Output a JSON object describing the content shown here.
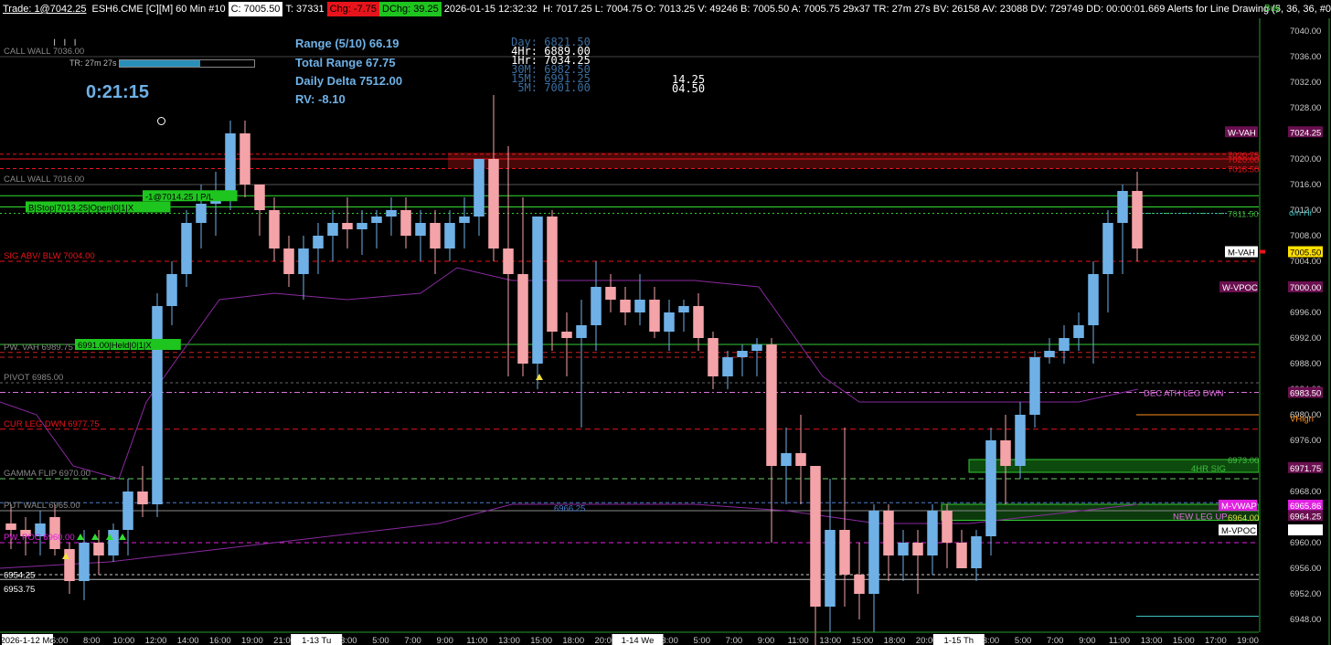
{
  "topbar": {
    "trade": "Trade: 1@7042.25",
    "symbol": "ESH6.CME [C][M]  60 Min  #10",
    "c_chip": "C: 7005.50",
    "totals": "T: 37331",
    "chg": "Chg: -7.75",
    "dchg": "DChg: 39.25",
    "datetime": "2026-01-15 12:32:32",
    "ohlc": "H: 7017.25  L: 7004.75  O: 7013.25  V: 49246  B: 7005.50  A: 7005.75  29x37  TR: 27m 27s  BV: 26158  AV: 23088  DV: 729749  DD: 00:00:01.669  Alerts for Line Drawing   (5, 36, 36, #00FFFF, Dot, 1, Yes, Right, Yes, 9"
  },
  "stats": {
    "range": "Range (5/10) 66.19",
    "total_range": "Total Range 67.75",
    "daily_delta": "Daily Delta 7512.00",
    "rv": "RV: -8.10",
    "clock": "0:21:15",
    "tr_label": "TR: 27m 27s",
    "tr_progress": 0.6
  },
  "timeframes": [
    {
      "label": "Day:",
      "value": "6821.50",
      "color": "#3a6ea0"
    },
    {
      "label": "4Hr:",
      "value": "6889.00",
      "color": "#ffffff"
    },
    {
      "label": "1Hr:",
      "value": "7034.25",
      "color": "#ffffff"
    },
    {
      "label": "30M:",
      "value": "6982.50",
      "color": "#3a6ea0"
    },
    {
      "label": "15M:",
      "value": "6991.25",
      "color": "#3a6ea0"
    },
    {
      "label": "5M:",
      "value": "7001.00",
      "color": "#3a6ea0"
    }
  ],
  "aux_values": [
    "14.25",
    "04.50"
  ],
  "right_buy_label": "Buy",
  "chart_data": {
    "type": "candlestick",
    "ylim": [
      6946,
      7042
    ],
    "y_ticks": [
      7040,
      7036,
      7032,
      7028,
      7024,
      7020,
      7016,
      7012,
      7008,
      7004,
      7000,
      6996,
      6992,
      6988,
      6984,
      6980,
      6976,
      6972,
      6968,
      6964,
      6960,
      6956,
      6952,
      6948
    ],
    "y_tick_labels": [
      "7040.00",
      "7036.00",
      "7032.00",
      "7028.00",
      "7024.00",
      "7020.00",
      "7016.00",
      "7012.00",
      "7008.00",
      "7004.00",
      "7000.00",
      "6996.00",
      "6992.00",
      "6988.00",
      "6984.00",
      "6980.00",
      "6976.00",
      "6972.00",
      "6968.00",
      "6964.00",
      "6960.00",
      "6956.00",
      "6952.00",
      "6948.00"
    ],
    "x_labels": [
      "2026-1-12 Mo",
      "6:00",
      "8:00",
      "10:00",
      "12:00",
      "14:00",
      "16:00",
      "19:00",
      "21:00",
      "1-13 Tu",
      "3:00",
      "5:00",
      "7:00",
      "9:00",
      "11:00",
      "13:00",
      "15:00",
      "18:00",
      "20:00",
      "1-14 We",
      "3:00",
      "5:00",
      "7:00",
      "9:00",
      "11:00",
      "13:00",
      "15:00",
      "18:00",
      "20:00",
      "1-15 Th",
      "3:00",
      "5:00",
      "7:00",
      "9:00",
      "11:00",
      "13:00",
      "15:00",
      "17:00",
      "19:00"
    ],
    "candles": [
      [
        6963,
        6966,
        6959,
        6962
      ],
      [
        6962,
        6964,
        6958,
        6961
      ],
      [
        6961,
        6965,
        6958,
        6963
      ],
      [
        6964,
        6966,
        6958,
        6959
      ],
      [
        6959,
        6960,
        6952,
        6954
      ],
      [
        6954,
        6962,
        6951,
        6960
      ],
      [
        6960,
        6962,
        6955,
        6958
      ],
      [
        6958,
        6963,
        6957,
        6962
      ],
      [
        6962,
        6970,
        6958,
        6968
      ],
      [
        6968,
        6972,
        6964,
        6966
      ],
      [
        6966,
        6999,
        6964,
        6997
      ],
      [
        6997,
        7004,
        6994,
        7002
      ],
      [
        7002,
        7012,
        7000,
        7010
      ],
      [
        7010,
        7016,
        7006,
        7013
      ],
      [
        7013,
        7018,
        7008,
        7014
      ],
      [
        7014,
        7026,
        7012,
        7024
      ],
      [
        7024,
        7026,
        7014,
        7016
      ],
      [
        7016,
        7016,
        7008,
        7012
      ],
      [
        7012,
        7014,
        7004,
        7006
      ],
      [
        7006,
        7008,
        7000,
        7002
      ],
      [
        7002,
        7008,
        6998,
        7006
      ],
      [
        7006,
        7010,
        7002,
        7008
      ],
      [
        7008,
        7012,
        7004,
        7010
      ],
      [
        7010,
        7014,
        7006,
        7009
      ],
      [
        7009,
        7012,
        7005,
        7010
      ],
      [
        7010,
        7012,
        7006,
        7011
      ],
      [
        7011,
        7014,
        7008,
        7012
      ],
      [
        7012,
        7014,
        7006,
        7008
      ],
      [
        7008,
        7012,
        7004,
        7010
      ],
      [
        7010,
        7012,
        7002,
        7006
      ],
      [
        7006,
        7012,
        7004,
        7010
      ],
      [
        7010,
        7014,
        7006,
        7011
      ],
      [
        7011,
        7020,
        7008,
        7020
      ],
      [
        7020,
        7030,
        7004,
        7006
      ],
      [
        7006,
        7022,
        6986,
        7002
      ],
      [
        7002,
        7014,
        6986,
        6988
      ],
      [
        6988,
        7006,
        6984,
        7011
      ],
      [
        7011,
        7012,
        6990,
        6993
      ],
      [
        6993,
        6996,
        6986,
        6992
      ],
      [
        6992,
        6998,
        6978,
        6994
      ],
      [
        6994,
        7004,
        6990,
        7000
      ],
      [
        7000,
        7002,
        6996,
        6998
      ],
      [
        6998,
        7000,
        6994,
        6996
      ],
      [
        6996,
        7002,
        6994,
        6998
      ],
      [
        6998,
        7000,
        6992,
        6993
      ],
      [
        6993,
        6998,
        6990,
        6996
      ],
      [
        6996,
        6998,
        6993,
        6997
      ],
      [
        6997,
        6999,
        6990,
        6992
      ],
      [
        6992,
        6993,
        6984,
        6986
      ],
      [
        6986,
        6990,
        6984,
        6989
      ],
      [
        6989,
        6991,
        6986,
        6990
      ],
      [
        6990,
        6992,
        6986,
        6991
      ],
      [
        6991,
        6992,
        6960,
        6972
      ],
      [
        6972,
        6978,
        6966,
        6974
      ],
      [
        6974,
        6980,
        6966,
        6972
      ],
      [
        6972,
        6972,
        6940,
        6950
      ],
      [
        6950,
        6970,
        6946,
        6962
      ],
      [
        6962,
        6978,
        6950,
        6955
      ],
      [
        6955,
        6960,
        6948,
        6952
      ],
      [
        6952,
        6966,
        6946,
        6965
      ],
      [
        6965,
        6966,
        6954,
        6958
      ],
      [
        6958,
        6962,
        6954,
        6960
      ],
      [
        6960,
        6962,
        6952,
        6958
      ],
      [
        6958,
        6966,
        6955,
        6965
      ],
      [
        6965,
        6966,
        6956,
        6960
      ],
      [
        6960,
        6962,
        6956,
        6956
      ],
      [
        6956,
        6962,
        6954,
        6961
      ],
      [
        6961,
        6978,
        6958,
        6976
      ],
      [
        6976,
        6980,
        6966,
        6972
      ],
      [
        6972,
        6982,
        6970,
        6980
      ],
      [
        6980,
        6990,
        6978,
        6989
      ],
      [
        6989,
        6992,
        6988,
        6990
      ],
      [
        6990,
        6994,
        6988,
        6992
      ],
      [
        6992,
        6996,
        6990,
        6994
      ],
      [
        6994,
        7004,
        6988,
        7002
      ],
      [
        7002,
        7012,
        6996,
        7010
      ],
      [
        7010,
        7016,
        7002,
        7015
      ],
      [
        7015,
        7018,
        7004,
        7006
      ]
    ],
    "levels": [
      {
        "name": "CALL WALL",
        "value": "7036.00",
        "color": "#888888"
      },
      {
        "name": "CALL WALL",
        "value": "7016.00",
        "color": "#888888"
      },
      {
        "name": "SIG ABV/ BLW",
        "value": "7004.00",
        "color": "#e8141b"
      },
      {
        "name": "PW. VAH",
        "value": "6989.75",
        "color": "#888888"
      },
      {
        "name": "PIVOT",
        "value": "6985.00",
        "color": "#888888"
      },
      {
        "name": "CUR LEG DWN",
        "value": "6977.75",
        "color": "#e8141b"
      },
      {
        "name": "GAMMA FLIP",
        "value": "6970.00",
        "color": "#888888"
      },
      {
        "name": "PUT WALL",
        "value": "6965.00",
        "color": "#888888"
      },
      {
        "name": "PW. POC",
        "value": "6960.00",
        "color": "#e020e0"
      }
    ],
    "right_labels": [
      {
        "text": "W-VAH",
        "value": "7024.25",
        "bg": "#6a1050",
        "fg": "#ffffff"
      },
      {
        "text": "7020.75",
        "value": "",
        "bg": "",
        "fg": "#e8141b"
      },
      {
        "text": "7020.00",
        "value": "",
        "bg": "",
        "fg": "#e8141b"
      },
      {
        "text": "7018.50",
        "value": "",
        "bg": "",
        "fg": "#e8141b"
      },
      {
        "text": "o/n Hi",
        "value": "",
        "bg": "",
        "fg": "#40c0c0"
      },
      {
        "text": "7011.50",
        "value": "",
        "bg": "",
        "fg": "#40b040"
      },
      {
        "text": "M-VAH",
        "value": "7005.50",
        "bg": "#ffe000",
        "fg": "#000000"
      },
      {
        "text": "W-VPOC",
        "value": "7000.00",
        "bg": "#6a1050",
        "fg": "#ffffff"
      },
      {
        "text": "DEC ATH LEG DWN",
        "value": "6983.50",
        "bg": "",
        "fg": "#e070e0"
      },
      {
        "text": "VHigh",
        "value": "",
        "bg": "",
        "fg": "#ff9020"
      },
      {
        "text": "6973.00",
        "value": "",
        "bg": "",
        "fg": "#40c040"
      },
      {
        "text": "4HR SIG",
        "value": "6971.75",
        "bg": "",
        "fg": "#40c040"
      },
      {
        "text": "M-VWAP",
        "value": "6965.86",
        "bg": "#e020e0",
        "fg": "#ffffff"
      },
      {
        "text": "NEW LEG UP",
        "value": "6964.25",
        "bg": "",
        "fg": "#e070e0"
      },
      {
        "text": "6964.00",
        "value": "",
        "bg": "",
        "fg": "#e0e040"
      },
      {
        "text": "M-VPOC",
        "value": "6962.00",
        "bg": "#ffffff",
        "fg": "#000000"
      }
    ],
    "orders": [
      {
        "text": "B|Stop|7013.25|Open|0|1|X",
        "value": 7012.5
      },
      {
        "text": "-1@7014.25 | P/L",
        "value": 7014.25
      },
      {
        "text": "6991.00|Held|0|1|X",
        "value": 6991.0
      }
    ],
    "price_tags": [
      "6954.25",
      "6953.75",
      "6966.25",
      "14.25",
      "04.50"
    ],
    "current_price": "7005.50"
  }
}
